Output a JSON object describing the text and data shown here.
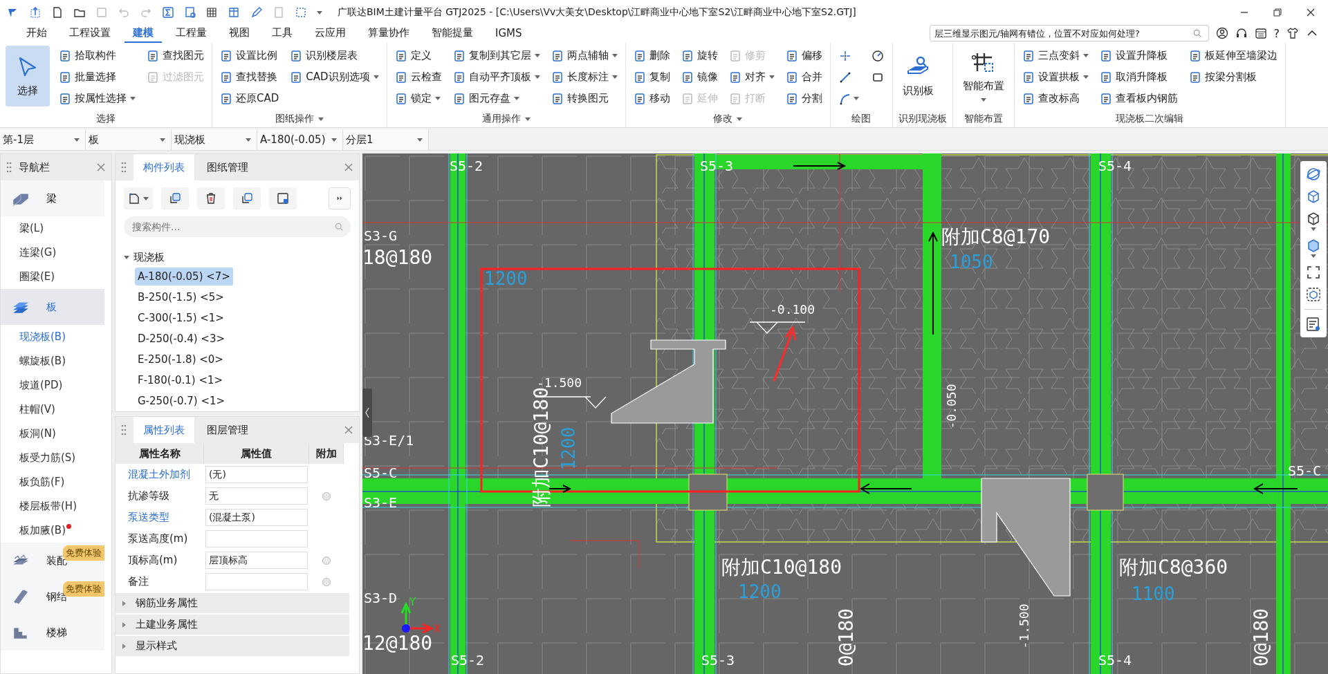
{
  "title_bar": {
    "title": "广联达BIM土建计量平台 GTJ2025 - [C:\\Users\\Vv大美女\\Desktop\\江畔商业中心地下室S2\\江畔商业中心地下室S2.GTJ]"
  },
  "menu_tabs": [
    {
      "label": "开始",
      "selected": false
    },
    {
      "label": "工程设置",
      "selected": false
    },
    {
      "label": "建模",
      "selected": true
    },
    {
      "label": "工程量",
      "selected": false
    },
    {
      "label": "视图",
      "selected": false
    },
    {
      "label": "工具",
      "selected": false
    },
    {
      "label": "云应用",
      "selected": false
    },
    {
      "label": "算量协作",
      "selected": false
    },
    {
      "label": "智能提量",
      "selected": false
    },
    {
      "label": "IGMS",
      "selected": false
    }
  ],
  "help_search": {
    "placeholder": "层三维显示图元/轴网有错位，位置不对应如何处理?"
  },
  "help_menu": "?",
  "ribbon": {
    "groups": [
      {
        "label": "选择",
        "has_menu": false,
        "columns": [
          {
            "kind": "large",
            "label": "选择",
            "selected": true
          },
          {
            "kind": "small",
            "items": [
              {
                "label": "拾取构件",
                "dropdown": false,
                "disabled": false
              },
              {
                "label": "批量选择",
                "dropdown": false,
                "disabled": false
              },
              {
                "label": "按属性选择",
                "dropdown": true,
                "disabled": false
              }
            ]
          },
          {
            "kind": "small",
            "items": [
              {
                "label": "查找图元",
                "dropdown": false,
                "disabled": false
              },
              {
                "label": "过滤图元",
                "dropdown": false,
                "disabled": true
              }
            ]
          }
        ]
      },
      {
        "label": "图纸操作",
        "has_menu": true,
        "columns": [
          {
            "kind": "small",
            "items": [
              {
                "label": "设置比例",
                "dropdown": false,
                "disabled": false
              },
              {
                "label": "查找替换",
                "dropdown": false,
                "disabled": false
              },
              {
                "label": "还原CAD",
                "dropdown": false,
                "disabled": false
              }
            ]
          },
          {
            "kind": "small",
            "items": [
              {
                "label": "识别楼层表",
                "dropdown": false,
                "disabled": false
              },
              {
                "label": "CAD识别选项",
                "dropdown": true,
                "disabled": false
              }
            ]
          }
        ]
      },
      {
        "label": "通用操作",
        "has_menu": true,
        "columns": [
          {
            "kind": "small",
            "items": [
              {
                "label": "定义",
                "dropdown": false,
                "disabled": false
              },
              {
                "label": "云检查",
                "dropdown": false,
                "disabled": false
              },
              {
                "label": "锁定",
                "dropdown": true,
                "disabled": false
              }
            ]
          },
          {
            "kind": "small",
            "items": [
              {
                "label": "复制到其它层",
                "dropdown": true,
                "disabled": false
              },
              {
                "label": "自动平齐顶板",
                "dropdown": true,
                "disabled": false
              },
              {
                "label": "图元存盘",
                "dropdown": true,
                "disabled": false
              }
            ]
          },
          {
            "kind": "small",
            "items": [
              {
                "label": "两点辅轴",
                "dropdown": true,
                "disabled": false
              },
              {
                "label": "长度标注",
                "dropdown": true,
                "disabled": false
              },
              {
                "label": "转换图元",
                "dropdown": false,
                "disabled": false
              }
            ]
          }
        ]
      },
      {
        "label": "修改",
        "has_menu": true,
        "columns": [
          {
            "kind": "small",
            "items": [
              {
                "label": "删除",
                "dropdown": false,
                "disabled": false
              },
              {
                "label": "复制",
                "dropdown": false,
                "disabled": false
              },
              {
                "label": "移动",
                "dropdown": false,
                "disabled": false
              }
            ]
          },
          {
            "kind": "small",
            "items": [
              {
                "label": "旋转",
                "dropdown": false,
                "disabled": false
              },
              {
                "label": "镜像",
                "dropdown": false,
                "disabled": false
              },
              {
                "label": "延伸",
                "dropdown": false,
                "disabled": true
              }
            ]
          },
          {
            "kind": "small",
            "items": [
              {
                "label": "修剪",
                "dropdown": false,
                "disabled": true
              },
              {
                "label": "对齐",
                "dropdown": true,
                "disabled": false
              },
              {
                "label": "打断",
                "dropdown": false,
                "disabled": true
              }
            ]
          },
          {
            "kind": "small",
            "items": [
              {
                "label": "偏移",
                "dropdown": false,
                "disabled": false
              },
              {
                "label": "合并",
                "dropdown": false,
                "disabled": false
              },
              {
                "label": "分割",
                "dropdown": false,
                "disabled": false
              }
            ]
          }
        ]
      },
      {
        "label": "绘图",
        "has_menu": false,
        "columns": [
          {
            "kind": "icons",
            "items": [
              {
                "dropdown": false
              },
              {
                "dropdown": false
              },
              {
                "dropdown": true
              }
            ]
          },
          {
            "kind": "icons",
            "items": [
              {
                "dropdown": false
              },
              {
                "dropdown": false
              }
            ]
          }
        ]
      },
      {
        "label": "识别现浇板",
        "has_menu": false,
        "columns": [
          {
            "kind": "large",
            "label": "识别板",
            "selected": false,
            "dropdown": false
          }
        ]
      },
      {
        "label": "智能布置",
        "has_menu": false,
        "columns": [
          {
            "kind": "large",
            "label": "智能布置",
            "selected": false,
            "dropdown": true
          }
        ]
      },
      {
        "label": "现浇板二次编辑",
        "has_menu": false,
        "columns": [
          {
            "kind": "small",
            "items": [
              {
                "label": "三点变斜",
                "dropdown": true,
                "disabled": false
              },
              {
                "label": "设置拱板",
                "dropdown": true,
                "disabled": false
              },
              {
                "label": "查改标高",
                "dropdown": false,
                "disabled": false
              }
            ]
          },
          {
            "kind": "small",
            "items": [
              {
                "label": "设置升降板",
                "dropdown": false,
                "disabled": false
              },
              {
                "label": "取消升降板",
                "dropdown": false,
                "disabled": false
              },
              {
                "label": "查看板内钢筋",
                "dropdown": false,
                "disabled": false
              }
            ]
          },
          {
            "kind": "small",
            "items": [
              {
                "label": "板延伸至墙梁边",
                "dropdown": false,
                "disabled": false
              },
              {
                "label": "按梁分割板",
                "dropdown": false,
                "disabled": false
              }
            ]
          }
        ]
      }
    ]
  },
  "selectors": [
    {
      "value": "第-1层"
    },
    {
      "value": "板"
    },
    {
      "value": "现浇板"
    },
    {
      "value": "A-180(-0.05)"
    },
    {
      "value": "分层1"
    }
  ],
  "nav": {
    "title": "导航栏",
    "items": [
      {
        "kind": "category",
        "label": "梁",
        "selected": false
      },
      {
        "kind": "item",
        "label": "梁(L)",
        "selected": false,
        "new_dot": false
      },
      {
        "kind": "item",
        "label": "连梁(G)",
        "selected": false,
        "new_dot": false
      },
      {
        "kind": "item",
        "label": "圈梁(E)",
        "selected": false,
        "new_dot": false
      },
      {
        "kind": "category",
        "label": "板",
        "selected": true
      },
      {
        "kind": "item",
        "label": "现浇板(B)",
        "selected": true,
        "new_dot": false
      },
      {
        "kind": "item",
        "label": "螺旋板(B)",
        "selected": false,
        "new_dot": false
      },
      {
        "kind": "item",
        "label": "坡道(PD)",
        "selected": false,
        "new_dot": false
      },
      {
        "kind": "item",
        "label": "柱帽(V)",
        "selected": false,
        "new_dot": false
      },
      {
        "kind": "item",
        "label": "板洞(N)",
        "selected": false,
        "new_dot": false
      },
      {
        "kind": "item",
        "label": "板受力筋(S)",
        "selected": false,
        "new_dot": false
      },
      {
        "kind": "item",
        "label": "板负筋(F)",
        "selected": false,
        "new_dot": false
      },
      {
        "kind": "item",
        "label": "楼层板带(H)",
        "selected": false,
        "new_dot": false
      },
      {
        "kind": "item",
        "label": "板加腋(B)",
        "selected": false,
        "new_dot": true
      },
      {
        "kind": "category",
        "label": "装配",
        "selected": false,
        "badge": "免费体验"
      },
      {
        "kind": "category",
        "label": "钢结",
        "selected": false,
        "badge": "免费体验"
      },
      {
        "kind": "category",
        "label": "楼梯",
        "selected": false
      }
    ]
  },
  "components": {
    "tabs": [
      {
        "label": "构件列表",
        "selected": true
      },
      {
        "label": "图纸管理",
        "selected": false
      }
    ],
    "search": {
      "placeholder": "搜索构件..."
    },
    "tree": [
      {
        "label": "现浇板",
        "expanded": true,
        "children": [
          {
            "label": "A-180(-0.05) <7>",
            "selected": true
          },
          {
            "label": "B-250(-1.5) <5>",
            "selected": false
          },
          {
            "label": "C-300(-1.5) <1>",
            "selected": false
          },
          {
            "label": "D-250(-0.4) <3>",
            "selected": false
          },
          {
            "label": "E-250(-1.8) <0>",
            "selected": false
          },
          {
            "label": "F-180(-0.1) <1>",
            "selected": false
          },
          {
            "label": "G-250(-0.7) <1>",
            "selected": false
          }
        ]
      }
    ]
  },
  "properties": {
    "tabs": [
      {
        "label": "属性列表",
        "selected": true
      },
      {
        "label": "图层管理",
        "selected": false
      }
    ],
    "columns": [
      "属性名称",
      "属性值",
      "附加"
    ],
    "rows": [
      {
        "name": "混凝土外加剂",
        "link": true,
        "value": "(无)",
        "kind": "plain"
      },
      {
        "name": "抗渗等级",
        "link": false,
        "value": "无",
        "kind": "extra",
        "checked": false
      },
      {
        "name": "泵送类型",
        "link": true,
        "value": "(混凝土泵)",
        "kind": "plain"
      },
      {
        "name": "泵送高度(m)",
        "link": false,
        "kind": "plain"
      },
      {
        "name": "顶标高(m)",
        "link": false,
        "value": "层顶标高",
        "kind": "extra",
        "checked": false
      },
      {
        "name": "备注",
        "link": false,
        "kind": "extra",
        "checked": false
      }
    ],
    "groups": [
      {
        "label": "钢筋业务属性",
        "expanded": false
      },
      {
        "label": "土建业务属性",
        "expanded": false
      },
      {
        "label": "显示样式",
        "expanded": false
      }
    ]
  },
  "canvas": {
    "labels": [
      {
        "text": "S5-2",
        "kind": "axis"
      },
      {
        "text": "S5-3",
        "kind": "axis"
      },
      {
        "text": "S5-4",
        "kind": "axis"
      },
      {
        "text": "S3-G",
        "kind": "axis"
      },
      {
        "text": "18@180",
        "kind": "rebar"
      },
      {
        "text": "附加C8@170",
        "kind": "rebar"
      },
      {
        "text": "1050",
        "kind": "length"
      },
      {
        "text": "1200",
        "kind": "length"
      },
      {
        "text": "-0.100",
        "kind": "elevation"
      },
      {
        "text": "-1.500",
        "kind": "elevation"
      },
      {
        "text": "附加C10@180",
        "kind": "rebar"
      },
      {
        "text": "1200",
        "kind": "length"
      },
      {
        "text": "-0.050",
        "kind": "elevation"
      },
      {
        "text": "S3-E/1",
        "kind": "axis"
      },
      {
        "text": "S5-C",
        "kind": "axis"
      },
      {
        "text": "S3-E",
        "kind": "axis"
      },
      {
        "text": "S5-C",
        "kind": "axis"
      },
      {
        "text": "附加C10@180",
        "kind": "rebar"
      },
      {
        "text": "附加C8@360",
        "kind": "rebar"
      },
      {
        "text": "S3-D",
        "kind": "axis"
      },
      {
        "text": "1200",
        "kind": "length"
      },
      {
        "text": "1100",
        "kind": "length"
      },
      {
        "text": "12@180",
        "kind": "rebar"
      },
      {
        "text": "S5-2",
        "kind": "axis"
      },
      {
        "text": "S5-3",
        "kind": "axis"
      },
      {
        "text": "S5-4",
        "kind": "axis"
      },
      {
        "text": "0@180",
        "kind": "rebar"
      },
      {
        "text": "0@180",
        "kind": "rebar"
      },
      {
        "text": "-1.500",
        "kind": "elevation"
      }
    ],
    "axis_indicator": {
      "x": "X",
      "y": "Y"
    }
  }
}
